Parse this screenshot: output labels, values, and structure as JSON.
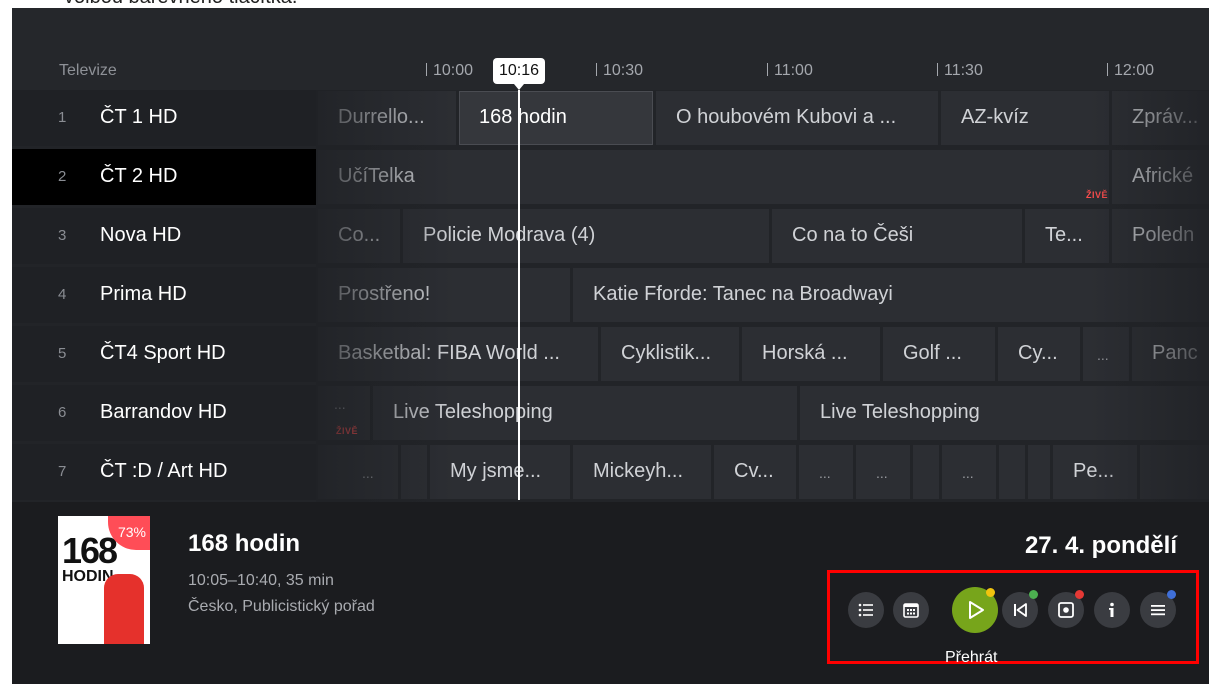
{
  "caption": "volbou barevného tlačítka.",
  "header": {
    "label": "Televize",
    "times": [
      "10:00",
      "10:30",
      "11:00",
      "11:30",
      "12:00"
    ],
    "now": "10:16"
  },
  "channels": [
    {
      "num": "1",
      "name": "ČT 1 HD"
    },
    {
      "num": "2",
      "name": "ČT 2 HD"
    },
    {
      "num": "3",
      "name": "Nova HD"
    },
    {
      "num": "4",
      "name": "Prima HD"
    },
    {
      "num": "5",
      "name": "ČT4 Sport HD"
    },
    {
      "num": "6",
      "name": "Barrandov HD"
    },
    {
      "num": "7",
      "name": "ČT :D / Art HD"
    }
  ],
  "programs": {
    "ch1": [
      "Durrello...",
      "168 hodin",
      "O houbovém Kubovi a ...",
      "AZ-kvíz",
      "Zpráv..."
    ],
    "ch2": [
      "UčíTelka",
      "Africké"
    ],
    "ch3": [
      "Co...",
      "Policie Modrava (4)",
      "Co na to Češi",
      "Te...",
      "Poledn"
    ],
    "ch4": [
      "Prostřeno!",
      "Katie Fforde: Tanec na Broadwayi"
    ],
    "ch5": [
      "Basketbal: FIBA World ...",
      "Cyklistik...",
      "Horská ...",
      "Golf ...",
      "Cy...",
      "...",
      "Panc"
    ],
    "ch6": [
      "...",
      "Live Teleshopping",
      "Live Teleshopping"
    ],
    "ch7": [
      "...",
      "My jsme...",
      "Mickeyh...",
      "Cv...",
      "...",
      "...",
      "...",
      "Pe..."
    ]
  },
  "live_tag": "ŽIVĚ",
  "detail": {
    "poster_text": "168",
    "poster_sub": "HODIN",
    "progress": "73%",
    "title": "168 hodin",
    "time": "10:05–10:40, 35 min",
    "genre": "Česko, Publicistický pořad",
    "date": "27. 4. pondělí"
  },
  "buttons": {
    "icons": [
      "list-icon",
      "calendar-icon",
      "play-icon",
      "skip-back-icon",
      "record-icon",
      "info-icon",
      "menu-icon"
    ],
    "play_label": "Přehrát"
  },
  "colors": {
    "play": "#77a51b",
    "yellow_key": "#f1c40f",
    "green_key": "#4caf50",
    "red_key": "#e53935",
    "blue_key": "#3f6fd8",
    "highlight": "#ff0000",
    "live": "#ff4d4d"
  }
}
